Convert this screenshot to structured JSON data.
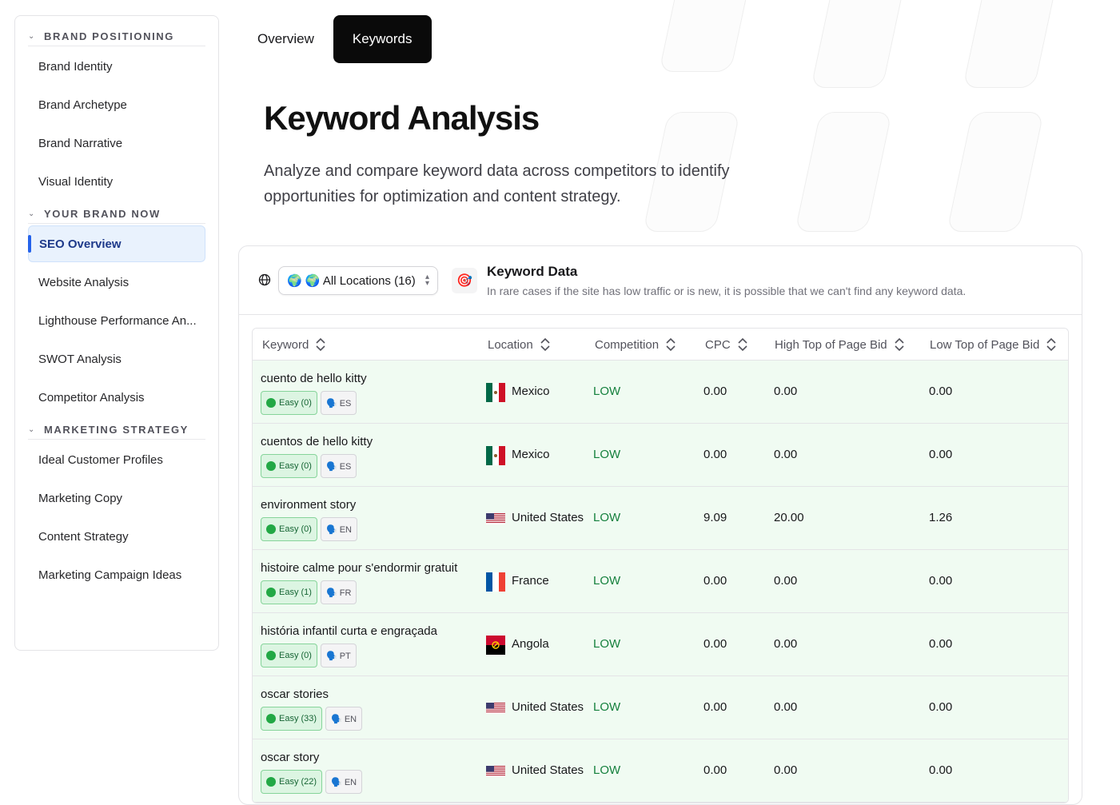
{
  "sidebar": {
    "sections": [
      {
        "title": "BRAND POSITIONING",
        "items": [
          "Brand Identity",
          "Brand Archetype",
          "Brand Narrative",
          "Visual Identity"
        ]
      },
      {
        "title": "YOUR BRAND NOW",
        "items": [
          "SEO Overview",
          "Website Analysis",
          "Lighthouse Performance An...",
          "SWOT Analysis",
          "Competitor Analysis"
        ]
      },
      {
        "title": "MARKETING STRATEGY",
        "items": [
          "Ideal Customer Profiles",
          "Marketing Copy",
          "Content Strategy",
          "Marketing Campaign Ideas"
        ]
      }
    ],
    "active_item": "SEO Overview"
  },
  "tabs": [
    {
      "label": "Overview",
      "active": false
    },
    {
      "label": "Keywords",
      "active": true
    }
  ],
  "page": {
    "title": "Keyword Analysis",
    "description": "Analyze and compare keyword data across competitors to identify opportunities for optimization and content strategy."
  },
  "panel": {
    "location_select": "🌍 🌍 All Locations (16)",
    "section_title": "Keyword Data",
    "section_subtitle": "In rare cases if the site has low traffic or is new, it is possible that we can't find any keyword data.",
    "section_icon": "🎯"
  },
  "table": {
    "columns": [
      "Keyword",
      "Location",
      "Competition",
      "CPC",
      "High Top of Page Bid",
      "Low Top of Page Bid"
    ],
    "rows": [
      {
        "keyword": "cuento de hello kitty",
        "difficulty": "Easy (0)",
        "lang": "🗣️ ES",
        "flag": "mx",
        "location": "Mexico",
        "competition": "LOW",
        "cpc": "0.00",
        "high": "0.00",
        "low": "0.00"
      },
      {
        "keyword": "cuentos de hello kitty",
        "difficulty": "Easy (0)",
        "lang": "🗣️ ES",
        "flag": "mx",
        "location": "Mexico",
        "competition": "LOW",
        "cpc": "0.00",
        "high": "0.00",
        "low": "0.00"
      },
      {
        "keyword": "environment story",
        "difficulty": "Easy (0)",
        "lang": "🗣️ EN",
        "flag": "us",
        "location": "United States",
        "competition": "LOW",
        "cpc": "9.09",
        "high": "20.00",
        "low": "1.26"
      },
      {
        "keyword": "histoire calme pour s'endormir gratuit",
        "difficulty": "Easy (1)",
        "lang": "🗣️ FR",
        "flag": "fr",
        "location": "France",
        "competition": "LOW",
        "cpc": "0.00",
        "high": "0.00",
        "low": "0.00"
      },
      {
        "keyword": "história infantil curta e engraçada",
        "difficulty": "Easy (0)",
        "lang": "🗣️ PT",
        "flag": "ao",
        "location": "Angola",
        "competition": "LOW",
        "cpc": "0.00",
        "high": "0.00",
        "low": "0.00"
      },
      {
        "keyword": "oscar stories",
        "difficulty": "Easy (33)",
        "lang": "🗣️ EN",
        "flag": "us",
        "location": "United States",
        "competition": "LOW",
        "cpc": "0.00",
        "high": "0.00",
        "low": "0.00"
      },
      {
        "keyword": "oscar story",
        "difficulty": "Easy (22)",
        "lang": "🗣️ EN",
        "flag": "us",
        "location": "United States",
        "competition": "LOW",
        "cpc": "0.00",
        "high": "0.00",
        "low": "0.00"
      }
    ]
  },
  "colors": {
    "accent": "#2563eb",
    "row_bg": "#f0fbf2",
    "competition_low": "#15803d",
    "tab_active_bg": "#0a0a0a"
  }
}
